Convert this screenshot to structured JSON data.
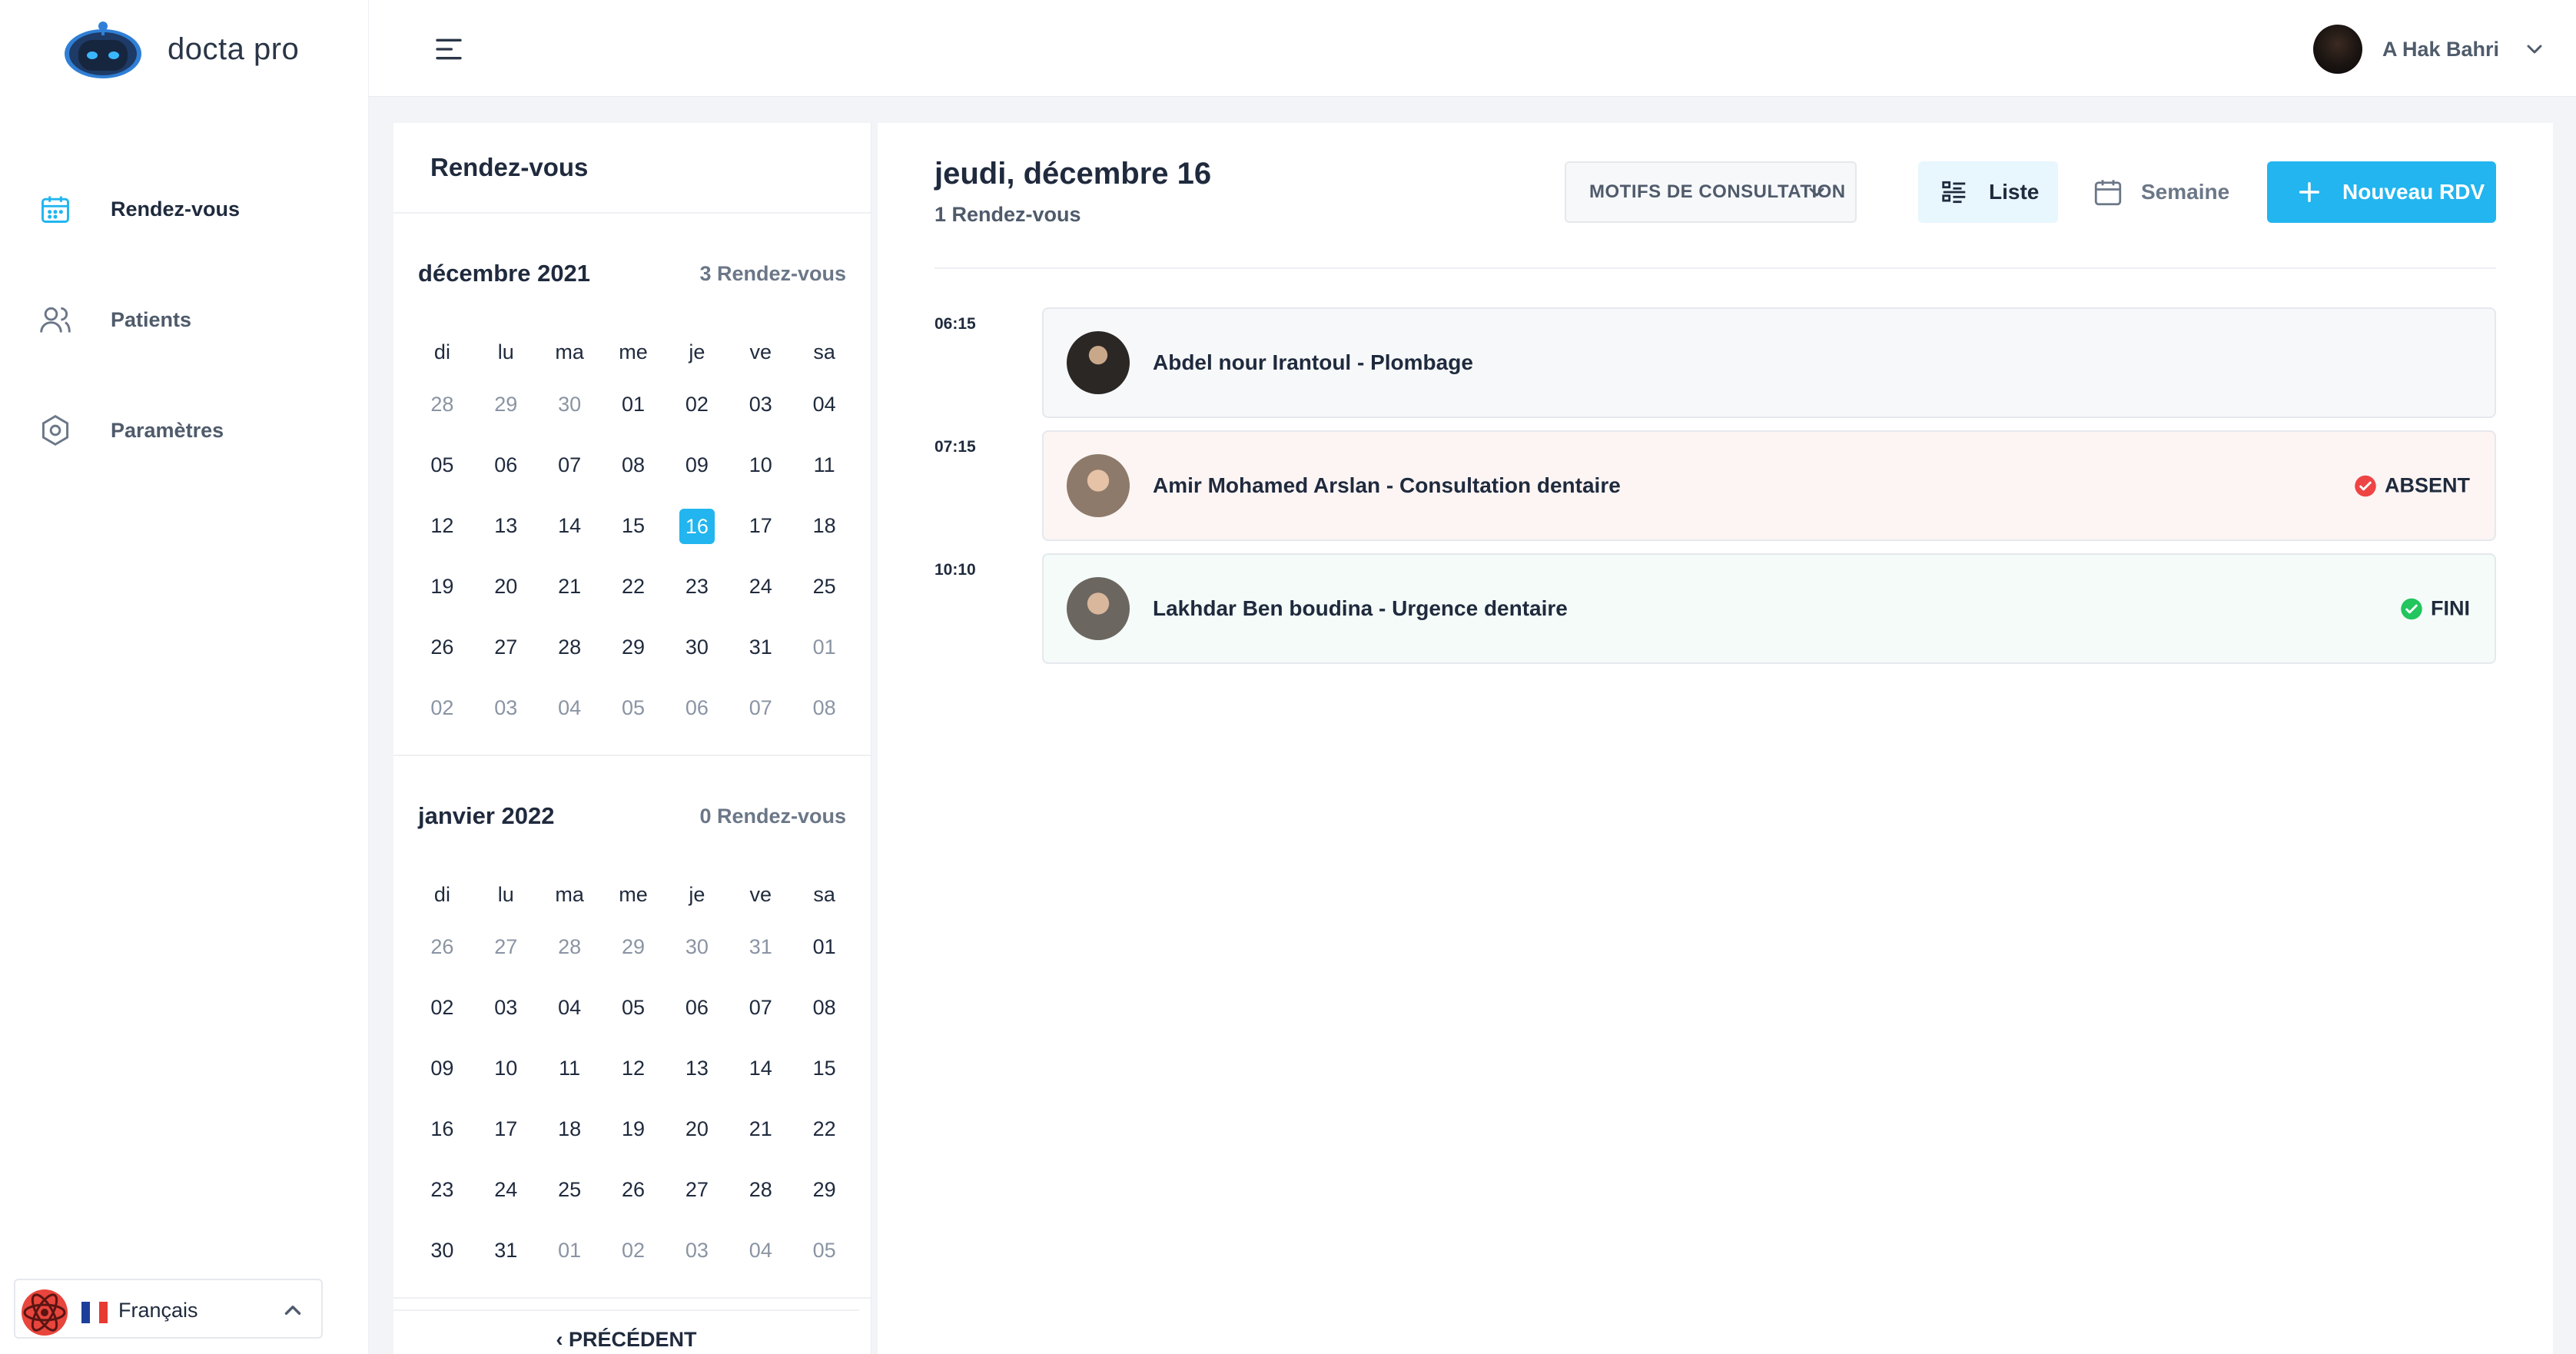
{
  "app": {
    "name": "docta pro"
  },
  "sidebar": {
    "items": [
      {
        "label": "Rendez-vous",
        "icon": "calendar-icon",
        "active": true
      },
      {
        "label": "Patients",
        "icon": "users-icon",
        "active": false
      },
      {
        "label": "Paramètres",
        "icon": "settings-hexagon-icon",
        "active": false
      }
    ],
    "language": {
      "label": "Français",
      "icon": "chevron-up-icon"
    }
  },
  "topbar": {
    "menu_icon": "hamburger-menu-icon",
    "user_name": "A Hak Bahri"
  },
  "calendar": {
    "title": "Rendez-vous",
    "weekdays": [
      "di",
      "lu",
      "ma",
      "me",
      "je",
      "ve",
      "sa"
    ],
    "months": [
      {
        "name": "décembre 2021",
        "count_label": "3 Rendez-vous",
        "weeks": [
          [
            {
              "d": "28",
              "m": true
            },
            {
              "d": "29",
              "m": true
            },
            {
              "d": "30",
              "m": true
            },
            {
              "d": "01"
            },
            {
              "d": "02"
            },
            {
              "d": "03"
            },
            {
              "d": "04"
            }
          ],
          [
            {
              "d": "05"
            },
            {
              "d": "06"
            },
            {
              "d": "07"
            },
            {
              "d": "08"
            },
            {
              "d": "09"
            },
            {
              "d": "10"
            },
            {
              "d": "11"
            }
          ],
          [
            {
              "d": "12"
            },
            {
              "d": "13"
            },
            {
              "d": "14"
            },
            {
              "d": "15"
            },
            {
              "d": "16",
              "sel": true
            },
            {
              "d": "17"
            },
            {
              "d": "18"
            }
          ],
          [
            {
              "d": "19"
            },
            {
              "d": "20"
            },
            {
              "d": "21"
            },
            {
              "d": "22"
            },
            {
              "d": "23"
            },
            {
              "d": "24"
            },
            {
              "d": "25"
            }
          ],
          [
            {
              "d": "26"
            },
            {
              "d": "27"
            },
            {
              "d": "28"
            },
            {
              "d": "29"
            },
            {
              "d": "30"
            },
            {
              "d": "31"
            },
            {
              "d": "01",
              "m": true
            }
          ],
          [
            {
              "d": "02",
              "m": true
            },
            {
              "d": "03",
              "m": true
            },
            {
              "d": "04",
              "m": true
            },
            {
              "d": "05",
              "m": true
            },
            {
              "d": "06",
              "m": true
            },
            {
              "d": "07",
              "m": true
            },
            {
              "d": "08",
              "m": true
            }
          ]
        ]
      },
      {
        "name": "janvier 2022",
        "count_label": "0 Rendez-vous",
        "weeks": [
          [
            {
              "d": "26",
              "m": true
            },
            {
              "d": "27",
              "m": true
            },
            {
              "d": "28",
              "m": true
            },
            {
              "d": "29",
              "m": true
            },
            {
              "d": "30",
              "m": true
            },
            {
              "d": "31",
              "m": true
            },
            {
              "d": "01"
            }
          ],
          [
            {
              "d": "02"
            },
            {
              "d": "03"
            },
            {
              "d": "04"
            },
            {
              "d": "05"
            },
            {
              "d": "06"
            },
            {
              "d": "07"
            },
            {
              "d": "08"
            }
          ],
          [
            {
              "d": "09"
            },
            {
              "d": "10"
            },
            {
              "d": "11"
            },
            {
              "d": "12"
            },
            {
              "d": "13"
            },
            {
              "d": "14"
            },
            {
              "d": "15"
            }
          ],
          [
            {
              "d": "16"
            },
            {
              "d": "17"
            },
            {
              "d": "18"
            },
            {
              "d": "19"
            },
            {
              "d": "20"
            },
            {
              "d": "21"
            },
            {
              "d": "22"
            }
          ],
          [
            {
              "d": "23"
            },
            {
              "d": "24"
            },
            {
              "d": "25"
            },
            {
              "d": "26"
            },
            {
              "d": "27"
            },
            {
              "d": "28"
            },
            {
              "d": "29"
            }
          ],
          [
            {
              "d": "30"
            },
            {
              "d": "31"
            },
            {
              "d": "01",
              "m": true
            },
            {
              "d": "02",
              "m": true
            },
            {
              "d": "03",
              "m": true
            },
            {
              "d": "04",
              "m": true
            },
            {
              "d": "05",
              "m": true
            }
          ]
        ]
      }
    ],
    "prev_label": "‹   PRÉCÉDENT"
  },
  "main": {
    "day_title": "jeudi, décembre 16",
    "day_subtitle": "1 Rendez-vous",
    "motifs_label": "MOTIFS DE CONSULTATION",
    "liste_label": "Liste",
    "semaine_label": "Semaine",
    "new_label": "Nouveau RDV",
    "appointments": [
      {
        "time": "06:15",
        "text": "Abdel nour Irantoul - Plombage",
        "status": "",
        "bg": "#f7f8fa"
      },
      {
        "time": "07:15",
        "text": "Amir Mohamed Arslan - Consultation dentaire",
        "status": "ABSENT",
        "status_color": "#ef4444",
        "bg": "#fdf5f4"
      },
      {
        "time": "10:10",
        "text": "Lakhdar Ben boudina - Urgence dentaire",
        "status": "FINI",
        "status_color": "#22c55e",
        "bg": "#f4fbf8"
      }
    ]
  },
  "colors": {
    "accent": "#22b5ef",
    "text": "#1f2a3d",
    "muted": "#8a94a3"
  }
}
